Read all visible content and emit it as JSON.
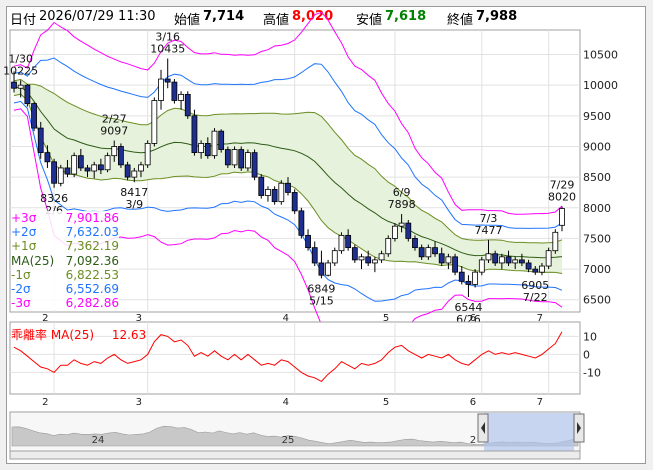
{
  "header": {
    "date_label": "日付",
    "datetime": "2026/07/29 11:30",
    "open_label": "始値",
    "open": "7,714",
    "high_label": "高値",
    "high": "8,020",
    "low_label": "安値",
    "low": "7,618",
    "close_label": "終値",
    "close": "7,988"
  },
  "colors": {
    "up": "#ffffff",
    "down": "#1f2f8f",
    "ma": "#2d5b16",
    "band1": "#6b8e23",
    "band2": "#1e74ff",
    "band3": "#ff00ff",
    "deviation": "#ff0000",
    "fill": "#e6f2dc"
  },
  "legend": [
    {
      "label": "+3σ",
      "value": "7,901.86",
      "color": "#ff00ff"
    },
    {
      "label": "+2σ",
      "value": "7,632.03",
      "color": "#1e74ff"
    },
    {
      "label": "+1σ",
      "value": "7,362.19",
      "color": "#6b8e23"
    },
    {
      "label": "MA(25)",
      "value": "7,092.36",
      "color": "#2d5b16"
    },
    {
      "label": "-1σ",
      "value": "6,822.53",
      "color": "#6b8e23"
    },
    {
      "label": "-2σ",
      "value": "6,552.69",
      "color": "#1e74ff"
    },
    {
      "label": "-3σ",
      "value": "6,282.86",
      "color": "#ff00ff"
    }
  ],
  "sub_label": "乖離率 MA(25)",
  "sub_value": "12.63",
  "nav_labels": [
    "24",
    "25",
    "2"
  ],
  "chart_data": {
    "type": "candlestick",
    "ylim": [
      6300,
      10900
    ],
    "y_ticks": [
      6500,
      7000,
      7500,
      8000,
      8500,
      9000,
      9500,
      10000,
      10500
    ],
    "x_ticks": [
      "2",
      "3",
      "4",
      "5",
      "6",
      "7"
    ],
    "candles": [
      [
        10050,
        10225,
        9880,
        9950
      ],
      [
        9950,
        10080,
        9800,
        10000
      ],
      [
        10000,
        10020,
        9650,
        9700
      ],
      [
        9700,
        9720,
        9250,
        9300
      ],
      [
        9300,
        9400,
        8800,
        8900
      ],
      [
        8900,
        9020,
        8650,
        8750
      ],
      [
        8750,
        8800,
        8326,
        8400
      ],
      [
        8400,
        8700,
        8350,
        8650
      ],
      [
        8650,
        8780,
        8500,
        8550
      ],
      [
        8550,
        8900,
        8500,
        8850
      ],
      [
        8850,
        8960,
        8600,
        8650
      ],
      [
        8650,
        8700,
        8500,
        8600
      ],
      [
        8600,
        8750,
        8480,
        8700
      ],
      [
        8700,
        8800,
        8550,
        8620
      ],
      [
        8620,
        8900,
        8580,
        8850
      ],
      [
        8850,
        9097,
        8750,
        9000
      ],
      [
        9000,
        9050,
        8650,
        8700
      ],
      [
        8700,
        8750,
        8450,
        8500
      ],
      [
        8500,
        8650,
        8417,
        8600
      ],
      [
        8600,
        8750,
        8500,
        8700
      ],
      [
        8700,
        9100,
        8650,
        9050
      ],
      [
        9050,
        9800,
        9000,
        9750
      ],
      [
        9750,
        10250,
        9600,
        10100
      ],
      [
        10100,
        10435,
        9950,
        10050
      ],
      [
        10050,
        10100,
        9700,
        9750
      ],
      [
        9750,
        9900,
        9600,
        9850
      ],
      [
        9850,
        9900,
        9450,
        9500
      ],
      [
        9500,
        9600,
        8850,
        8900
      ],
      [
        8900,
        9100,
        8800,
        9050
      ],
      [
        9050,
        9150,
        8800,
        8850
      ],
      [
        8850,
        9300,
        8800,
        9250
      ],
      [
        9250,
        9280,
        8900,
        8950
      ],
      [
        8950,
        9000,
        8650,
        8700
      ],
      [
        8700,
        9000,
        8650,
        8950
      ],
      [
        8950,
        9000,
        8600,
        8650
      ],
      [
        8650,
        8950,
        8600,
        8900
      ],
      [
        8900,
        8950,
        8450,
        8500
      ],
      [
        8500,
        8550,
        8150,
        8200
      ],
      [
        8200,
        8350,
        8100,
        8300
      ],
      [
        8300,
        8350,
        8050,
        8100
      ],
      [
        8100,
        8450,
        8050,
        8400
      ],
      [
        8400,
        8500,
        8200,
        8250
      ],
      [
        8250,
        8300,
        7900,
        7950
      ],
      [
        7950,
        8000,
        7500,
        7550
      ],
      [
        7550,
        7650,
        7300,
        7350
      ],
      [
        7350,
        7450,
        7050,
        7100
      ],
      [
        7100,
        7300,
        6849,
        6900
      ],
      [
        6900,
        7150,
        6880,
        7100
      ],
      [
        7100,
        7350,
        7050,
        7300
      ],
      [
        7300,
        7600,
        7250,
        7550
      ],
      [
        7550,
        7650,
        7300,
        7350
      ],
      [
        7350,
        7400,
        7100,
        7150
      ],
      [
        7150,
        7250,
        7000,
        7200
      ],
      [
        7200,
        7300,
        7050,
        7100
      ],
      [
        7100,
        7200,
        6950,
        7150
      ],
      [
        7150,
        7300,
        7100,
        7250
      ],
      [
        7250,
        7550,
        7200,
        7500
      ],
      [
        7500,
        7750,
        7450,
        7700
      ],
      [
        7700,
        7898,
        7600,
        7750
      ],
      [
        7750,
        7800,
        7450,
        7500
      ],
      [
        7500,
        7550,
        7300,
        7350
      ],
      [
        7350,
        7400,
        7150,
        7200
      ],
      [
        7200,
        7400,
        7150,
        7350
      ],
      [
        7350,
        7450,
        7200,
        7250
      ],
      [
        7250,
        7350,
        7050,
        7100
      ],
      [
        7100,
        7250,
        7000,
        7200
      ],
      [
        7200,
        7250,
        6900,
        6950
      ],
      [
        6950,
        7050,
        6750,
        6800
      ],
      [
        6800,
        6900,
        6544,
        6750
      ],
      [
        6750,
        7000,
        6700,
        6950
      ],
      [
        6950,
        7200,
        6900,
        7150
      ],
      [
        7150,
        7477,
        7100,
        7250
      ],
      [
        7250,
        7300,
        7050,
        7100
      ],
      [
        7100,
        7250,
        7000,
        7200
      ],
      [
        7200,
        7300,
        7050,
        7100
      ],
      [
        7100,
        7200,
        7000,
        7150
      ],
      [
        7150,
        7250,
        7050,
        7100
      ],
      [
        7100,
        7150,
        6950,
        7000
      ],
      [
        7000,
        7050,
        6905,
        6950
      ],
      [
        6950,
        7100,
        6900,
        7050
      ],
      [
        7050,
        7350,
        7000,
        7300
      ],
      [
        7300,
        7650,
        7250,
        7600
      ],
      [
        7714,
        8020,
        7618,
        7988
      ]
    ],
    "x_tick_index": [
      6,
      20,
      42,
      57,
      70,
      80
    ],
    "annotations": [
      {
        "idx": 1,
        "lines": [
          "1/30",
          "10225"
        ],
        "pos": "above"
      },
      {
        "idx": 6,
        "lines": [
          "8326",
          "2/6"
        ],
        "pos": "below"
      },
      {
        "idx": 15,
        "lines": [
          "2/27",
          "9097"
        ],
        "pos": "above"
      },
      {
        "idx": 18,
        "lines": [
          "8417",
          "3/9"
        ],
        "pos": "below"
      },
      {
        "idx": 23,
        "lines": [
          "3/16",
          "10435"
        ],
        "pos": "above"
      },
      {
        "idx": 46,
        "lines": [
          "6849",
          "5/15"
        ],
        "pos": "below"
      },
      {
        "idx": 58,
        "lines": [
          "6/9",
          "7898"
        ],
        "pos": "above"
      },
      {
        "idx": 68,
        "lines": [
          "6544",
          "6/26"
        ],
        "pos": "below"
      },
      {
        "idx": 71,
        "lines": [
          "7/3",
          "7477"
        ],
        "pos": "above"
      },
      {
        "idx": 78,
        "lines": [
          "6905",
          "7/22"
        ],
        "pos": "below"
      },
      {
        "idx": 82,
        "lines": [
          "7/29",
          "8020"
        ],
        "pos": "above"
      }
    ],
    "deviation_ticks": [
      10,
      0,
      -10
    ],
    "deviation_ylim": [
      -22,
      18
    ],
    "deviation": [
      4,
      2,
      -1,
      -4,
      -7,
      -8,
      -10,
      -6,
      -6,
      -3,
      -5,
      -6,
      -4,
      -5,
      -2,
      0,
      -3,
      -5,
      -4,
      -3,
      0,
      7,
      11,
      10,
      7,
      8,
      5,
      -1,
      1,
      -1,
      2,
      -1,
      -3,
      0,
      -3,
      0,
      -3,
      -6,
      -5,
      -6,
      -3,
      -4,
      -7,
      -10,
      -12,
      -13,
      -15,
      -11,
      -8,
      -4,
      -6,
      -8,
      -5,
      -6,
      -5,
      -3,
      1,
      4,
      5,
      2,
      0,
      -2,
      0,
      -1,
      -2,
      0,
      -3,
      -5,
      -6,
      -3,
      0,
      2,
      0,
      1,
      0,
      1,
      0,
      -1,
      -2,
      0,
      3,
      6,
      12.6
    ]
  }
}
